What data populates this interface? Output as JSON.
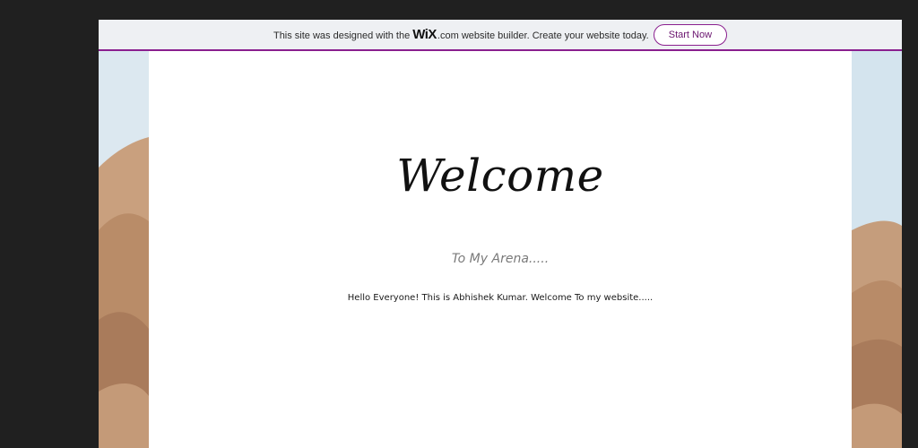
{
  "banner": {
    "text_before": "This site was designed with the",
    "logo": "WiX",
    "text_after": ".com website builder. Create your website today.",
    "button_label": "Start Now",
    "accent_color": "#8a1f8f"
  },
  "hero": {
    "title": "Welcome",
    "subtitle": "To My Arena.....",
    "intro": "Hello Everyone! This is Abhishek Kumar. Welcome To my website....."
  },
  "background": {
    "sky_color": "#d8e6ef",
    "dune_color": "#c49a78",
    "dune_shadow": "#a97b5b"
  }
}
